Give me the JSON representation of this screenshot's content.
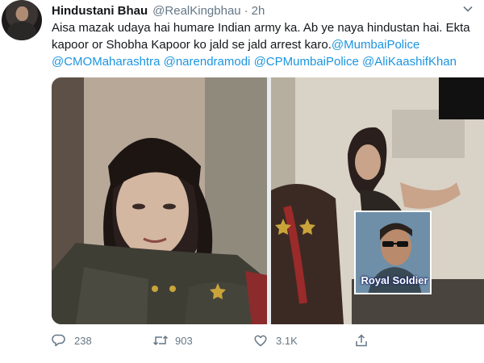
{
  "tweet": {
    "display_name": "Hindustani Bhau",
    "handle": "@RealKingbhau",
    "separator": "·",
    "time": "2h",
    "text_plain": "Aisa mazak udaya hai humare Indian army ka. Ab ye naya hindustan hai. Ekta kapoor or Shobha Kapoor ko jald se jald arrest karo.",
    "mentions": [
      "@MumbaiPolice",
      "@CMOMaharashtra",
      "@narendramodi",
      "@CPMumbaiPolice",
      "@AliKaashifKhan"
    ],
    "media": {
      "overlay_label": "Royal Soldier"
    },
    "actions": {
      "reply_icon": "reply-icon",
      "reply_count": "238",
      "retweet_icon": "retweet-icon",
      "retweet_count": "903",
      "like_icon": "heart-icon",
      "like_count": "3.1K",
      "share_icon": "share-icon"
    }
  },
  "colors": {
    "text": "#14171a",
    "muted": "#657786",
    "link": "#1b95e0",
    "background": "#ffffff"
  }
}
